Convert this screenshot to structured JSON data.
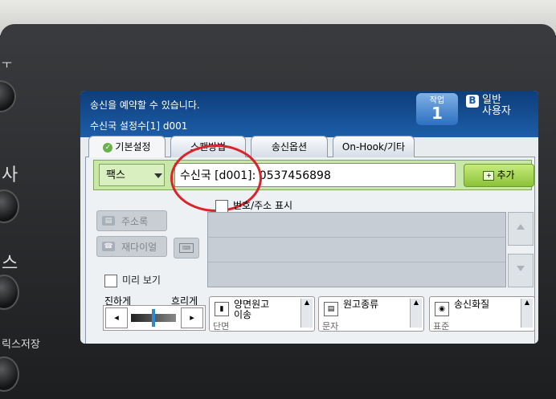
{
  "device": {
    "side_labels": [
      "ㅜ",
      "사",
      "스",
      "릭스저장"
    ]
  },
  "status": {
    "message": "송신을 예약할 수 있습니다.",
    "destination_count": "수신국 설정수[1] d001",
    "job_label": "작업",
    "job_number": "1",
    "user_label": "일반\n사용자"
  },
  "tabs": [
    {
      "label": "기본설정",
      "active": true
    },
    {
      "label": "스캔방법",
      "active": false
    },
    {
      "label": "송신옵션",
      "active": false
    },
    {
      "label": "On-Hook/기타",
      "active": false
    }
  ],
  "address": {
    "mode": "팩스",
    "field_value": "수신국 [d001]: 0537456898",
    "add_label": "추가"
  },
  "left_controls": {
    "address_book": "주소록",
    "dial": "재다이얼",
    "preview": "미리 보기"
  },
  "list": {
    "show_label": "번호/주소 표시"
  },
  "density": {
    "dark_label": "진하게",
    "light_label": "흐리게",
    "left": "◂",
    "right": "▸"
  },
  "options": [
    {
      "title": "양면원고\n이송",
      "value": "단면",
      "icon": "duplex-icon"
    },
    {
      "title": "원고종류",
      "value": "문자",
      "icon": "document-icon"
    },
    {
      "title": "송신화질",
      "value": "표준",
      "icon": "quality-icon"
    }
  ],
  "colors": {
    "header": "#1d5ea8",
    "address_row": "#c9e7a7",
    "annotation_circle": "#d8242a"
  }
}
